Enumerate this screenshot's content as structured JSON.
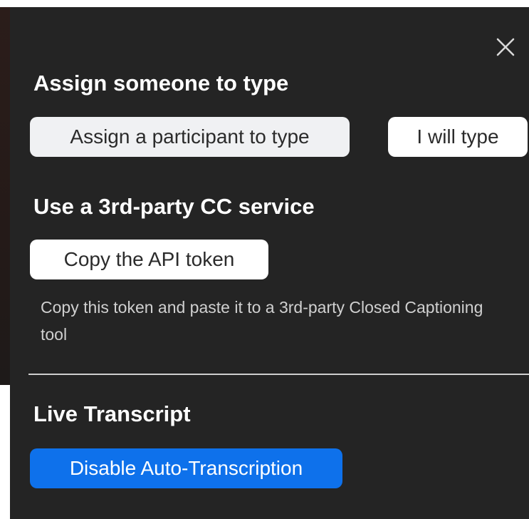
{
  "assign_section": {
    "title": "Assign someone to type",
    "assign_button": "Assign a participant to type",
    "self_button": "I will type"
  },
  "third_party_section": {
    "title": "Use a 3rd-party CC service",
    "copy_button": "Copy the API token",
    "helper_text": "Copy this token and paste it to a 3rd-party Closed Captioning tool"
  },
  "live_transcript_section": {
    "title": "Live Transcript",
    "disable_button": "Disable Auto-Transcription"
  },
  "colors": {
    "panel_background": "#242424",
    "primary_accent": "#0e71eb",
    "heading_text": "#ffffff",
    "helper_text": "#d0d0d0"
  },
  "icons": {
    "close": "close-icon"
  }
}
